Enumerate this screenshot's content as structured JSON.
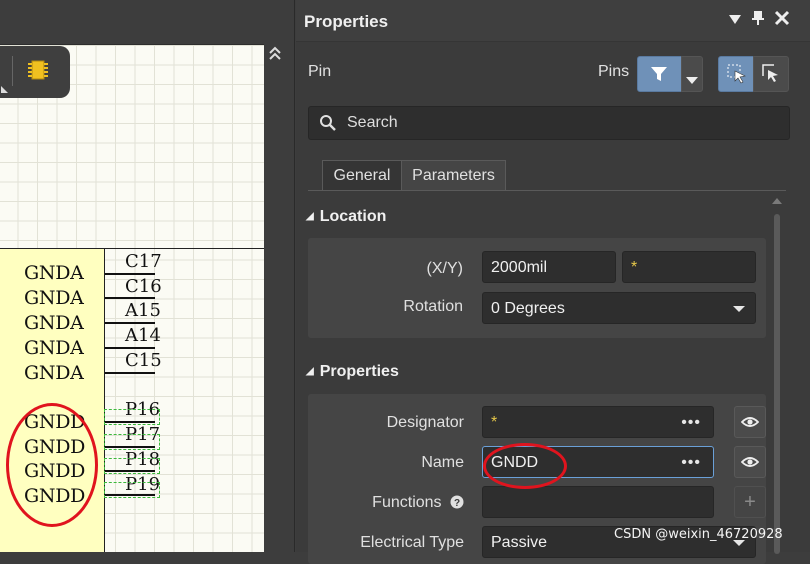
{
  "schematic": {
    "toolbar_icon": "ic-chip-icon",
    "collapse_icon": "double-chevron-up-icon",
    "pins": [
      {
        "name": "GNDA",
        "number": "C17"
      },
      {
        "name": "GNDA",
        "number": "C16"
      },
      {
        "name": "GNDA",
        "number": "A15"
      },
      {
        "name": "GNDA",
        "number": "A14"
      },
      {
        "name": "GNDA",
        "number": "C15"
      },
      {
        "name": "GNDD",
        "number": "P16"
      },
      {
        "name": "GNDD",
        "number": "P17"
      },
      {
        "name": "GNDD",
        "number": "P18"
      },
      {
        "name": "GNDD",
        "number": "P19"
      }
    ],
    "highlight_color": "#e0141e",
    "body_color": "#ffffc0"
  },
  "panel": {
    "title": "Properties",
    "title_controls": [
      "dropdown-icon",
      "pin-icon",
      "close-icon"
    ],
    "object_kind": "Pin",
    "filter_label": "Pins",
    "search_placeholder": "Search",
    "tabs": [
      {
        "label": "General",
        "active": true
      },
      {
        "label": "Parameters",
        "active": false
      }
    ],
    "location": {
      "heading": "Location",
      "xy_label": "(X/Y)",
      "x_value": "2000mil",
      "y_value": "*",
      "rotation_label": "Rotation",
      "rotation_value": "0 Degrees"
    },
    "properties": {
      "heading": "Properties",
      "designator_label": "Designator",
      "designator_value": "*",
      "name_label": "Name",
      "name_value": "GNDD",
      "functions_label": "Functions",
      "electrical_type_label": "Electrical Type",
      "electrical_type_value": "Passive"
    },
    "accent_color": "#6f91b8"
  },
  "watermark": "CSDN @weixin_46720928"
}
